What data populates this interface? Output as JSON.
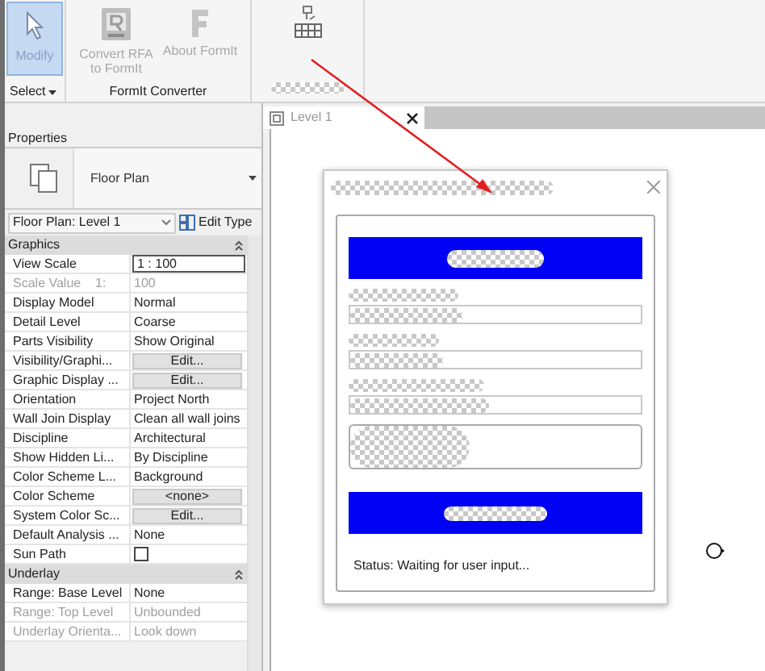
{
  "ribbon": {
    "buttons": [
      {
        "label": "Modify",
        "kind": "select",
        "selected": true,
        "disabled": false
      },
      {
        "label": "Convert RFA to FormIt",
        "kind": "convert",
        "selected": false,
        "disabled": true
      },
      {
        "label": "About FormIt",
        "kind": "about",
        "selected": false,
        "disabled": true
      }
    ],
    "select_label": "Select",
    "panel_label": "FormIt Converter"
  },
  "properties": {
    "title": "Properties",
    "type_name": "Floor Plan",
    "view_selector": "Floor Plan: Level 1",
    "edit_type": "Edit Type",
    "sections": [
      {
        "title": "Graphics",
        "expanded": true,
        "rows": [
          {
            "label": "View Scale",
            "value": "1 : 100",
            "kind": "field",
            "disabled": false
          },
          {
            "label": "Scale Value    1:",
            "value": "100",
            "kind": "text",
            "disabled": true
          },
          {
            "label": "Display Model",
            "value": "Normal",
            "kind": "text",
            "disabled": false
          },
          {
            "label": "Detail Level",
            "value": "Coarse",
            "kind": "text",
            "disabled": false
          },
          {
            "label": "Parts Visibility",
            "value": "Show Original",
            "kind": "text",
            "disabled": false
          },
          {
            "label": "Visibility/Graphi...",
            "value": "Edit...",
            "kind": "button",
            "disabled": false
          },
          {
            "label": "Graphic Display ...",
            "value": "Edit...",
            "kind": "button",
            "disabled": false
          },
          {
            "label": "Orientation",
            "value": "Project North",
            "kind": "text",
            "disabled": false
          },
          {
            "label": "Wall Join Display",
            "value": "Clean all wall joins",
            "kind": "text",
            "disabled": false
          },
          {
            "label": "Discipline",
            "value": "Architectural",
            "kind": "text",
            "disabled": false
          },
          {
            "label": "Show Hidden Li...",
            "value": "By Discipline",
            "kind": "text",
            "disabled": false
          },
          {
            "label": "Color Scheme L...",
            "value": "Background",
            "kind": "text",
            "disabled": false
          },
          {
            "label": "Color Scheme",
            "value": "<none>",
            "kind": "button",
            "disabled": false
          },
          {
            "label": "System Color Sc...",
            "value": "Edit...",
            "kind": "button",
            "disabled": false
          },
          {
            "label": "Default Analysis ...",
            "value": "None",
            "kind": "text",
            "disabled": false
          },
          {
            "label": "Sun Path",
            "kind": "checkbox",
            "checked": false,
            "disabled": false
          }
        ]
      },
      {
        "title": "Underlay",
        "expanded": true,
        "rows": [
          {
            "label": "Range: Base Level",
            "value": "None",
            "kind": "text",
            "disabled": false
          },
          {
            "label": "Range: Top Level",
            "value": "Unbounded",
            "kind": "text",
            "disabled": true
          },
          {
            "label": "Underlay Orienta...",
            "value": "Look down",
            "kind": "text",
            "disabled": true
          }
        ]
      }
    ]
  },
  "view_tab": {
    "label": "Level 1",
    "selected": true
  },
  "dialog": {
    "status": "Status: Waiting for user input..."
  }
}
